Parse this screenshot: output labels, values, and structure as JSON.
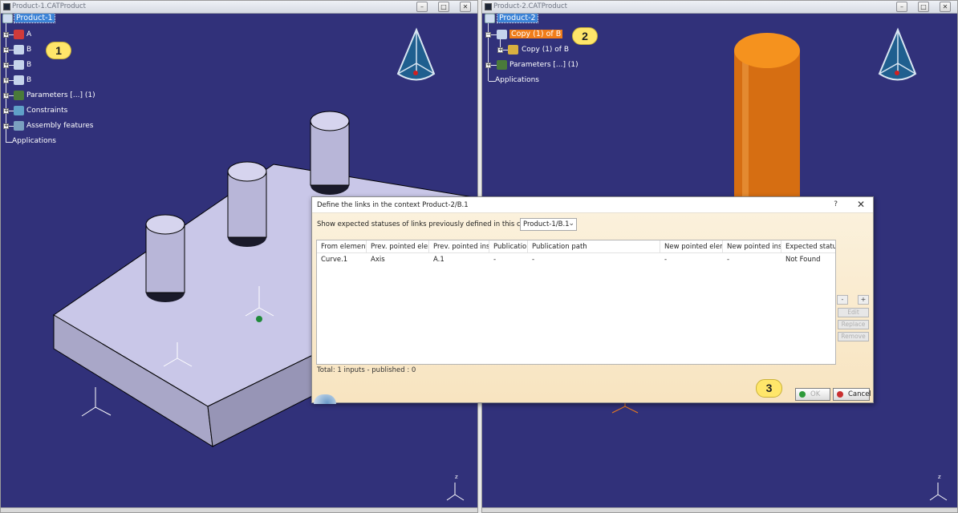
{
  "left_window": {
    "title": "Product-1.CATProduct",
    "tree": {
      "root": "Product-1",
      "items": [
        {
          "label": "A"
        },
        {
          "label": "B"
        },
        {
          "label": "B"
        },
        {
          "label": "B"
        },
        {
          "label": "Parameters [...] (1)"
        },
        {
          "label": "Constraints"
        },
        {
          "label": "Assembly features"
        },
        {
          "label": "Applications"
        }
      ]
    },
    "callout": "1"
  },
  "right_window": {
    "title": "Product-2.CATProduct",
    "tree": {
      "root": "Product-2",
      "items": [
        {
          "label": "Copy (1) of B"
        },
        {
          "label": "Copy (1) of B"
        },
        {
          "label": "Parameters [...] (1)"
        },
        {
          "label": "Applications"
        }
      ]
    },
    "callout": "2"
  },
  "dialog": {
    "title": "Define the links in the context Product-2/B.1",
    "help": "?",
    "close": "✕",
    "context_label": "Show expected statuses of links previously defined in this context :",
    "context_value": "Product-1/B.1",
    "columns": [
      "From element",
      "Prev. pointed elem",
      "Prev. pointed inst",
      "Publication",
      "Publication path",
      "New pointed elem",
      "New pointed inst",
      "Expected status"
    ],
    "rows": [
      [
        "Curve.1",
        "Axis",
        "A.1",
        "-",
        "-",
        "-",
        "-",
        "Not Found"
      ]
    ],
    "side_buttons": {
      "minus": "-",
      "plus": "+",
      "edit": "Edit",
      "replace": "Replace",
      "remove": "Remove"
    },
    "summary": "Total: 1 inputs - published : 0",
    "ok_label": "OK",
    "cancel_label": "Cancel",
    "callout": "3"
  },
  "axes": {
    "x": "x",
    "y": "y",
    "z": "z"
  },
  "colors": {
    "background": "#31317a",
    "highlight": "#f07d1a",
    "callout": "#ffe66a",
    "dialog": "#fbf1dc"
  }
}
